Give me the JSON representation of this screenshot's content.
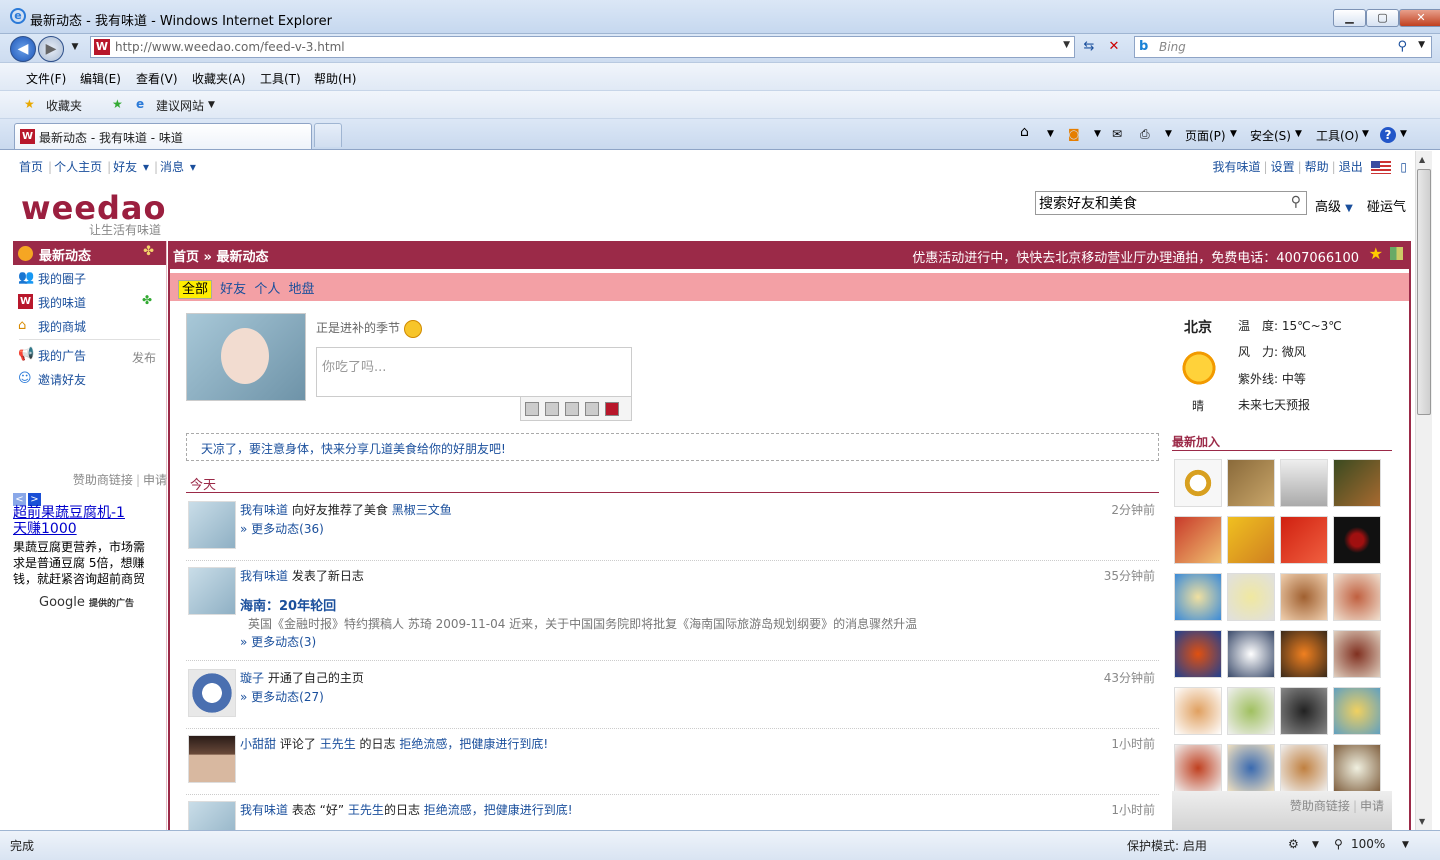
{
  "browser": {
    "title": "最新动态 - 我有味道 - Windows Internet Explorer",
    "url": "http://www.weedao.com/feed-v-3.html",
    "search_placeholder": "Bing",
    "menu": [
      "文件(F)",
      "编辑(E)",
      "查看(V)",
      "收藏夹(A)",
      "工具(T)",
      "帮助(H)"
    ],
    "favorites": "收藏夹",
    "suggested": "建议网站",
    "tab_title": "最新动态 - 我有味道 - 味道",
    "commands": {
      "page": "页面(P)",
      "safety": "安全(S)",
      "tools": "工具(O)"
    },
    "status_left": "完成",
    "protected_mode": "保护模式: 启用",
    "zoom": "100%"
  },
  "site": {
    "topnav": [
      "首页",
      "个人主页",
      "好友",
      "消息"
    ],
    "topright": [
      "我有味道",
      "设置",
      "帮助",
      "退出"
    ],
    "logo": "weedao",
    "slogan": "让生活有味道",
    "search_value": "搜索好友和美食",
    "advanced": "高级",
    "lucky": "碰运气"
  },
  "sidebar": {
    "head": "最新动态",
    "items": [
      "我的圈子",
      "我的味道",
      "我的商城",
      "我的广告",
      "邀请好友"
    ],
    "publish": "发布",
    "sponsor": "赞助商链接",
    "apply": "申请",
    "ad_title": "超前果蔬豆腐机-1天赚1000",
    "ad_body": "果蔬豆腐更营养，市场需求是普通豆腐 5倍，想赚钱，就赶紧咨询超前商贸",
    "google": "Google",
    "google_suffix": "提供的广告"
  },
  "main": {
    "breadcrumb_home": "首页",
    "breadcrumb_current": "最新动态",
    "promo": "优惠活动进行中，快快去北京移动营业厅办理通拍，免费电话：4007066100",
    "filters": [
      "全部",
      "好友",
      "个人",
      "地盘"
    ],
    "status": "正是进补的季节",
    "compose_placeholder": "你吃了吗...",
    "tip": "天凉了，要注意身体，快来分享几道美食给你的好朋友吧!",
    "today": "今天"
  },
  "feed": [
    {
      "user": "我有味道",
      "action": "向好友推荐了美食",
      "target": "黑椒三文鱼",
      "time": "2分钟前",
      "more": "» 更多动态(36)"
    },
    {
      "user": "我有味道",
      "action": "发表了新日志",
      "target": "",
      "time": "35分钟前",
      "title": "海南：20年轮回",
      "summary": "英国《金融时报》特约撰稿人 苏琦  2009-11-04   近来，关于中国国务院即将批复《海南国际旅游岛规划纲要》的消息骤然升温",
      "more": "» 更多动态(3)"
    },
    {
      "user": "璇子",
      "action": "开通了自己的主页",
      "target": "",
      "time": "43分钟前",
      "more": "» 更多动态(27)"
    },
    {
      "user": "小甜甜",
      "action": "评论了",
      "target": "王先生",
      "action2": "的日志",
      "target2": "拒绝流感，把健康进行到底!",
      "time": "1小时前",
      "more": ""
    },
    {
      "user": "我有味道",
      "action": "表态 “好”",
      "target": "王先生",
      "action2": "的日志",
      "target2": "拒绝流感，把健康进行到底!",
      "time": "1小时前",
      "more": ""
    }
  ],
  "weather": {
    "city": "北京",
    "condition": "晴",
    "temp_label": "温　度:",
    "temp": "15℃~3℃",
    "wind_label": "风　力:",
    "wind": "微风",
    "uv_label": "紫外线:",
    "uv": "中等",
    "forecast": "未来七天预报"
  },
  "new_join": "最新加入",
  "right_sponsor": "赞助商链接",
  "right_apply": "申请",
  "colors": {
    "brand": "#9b2a48",
    "link": "#1a4f9c",
    "filter_bg": "#f3a0a5"
  }
}
